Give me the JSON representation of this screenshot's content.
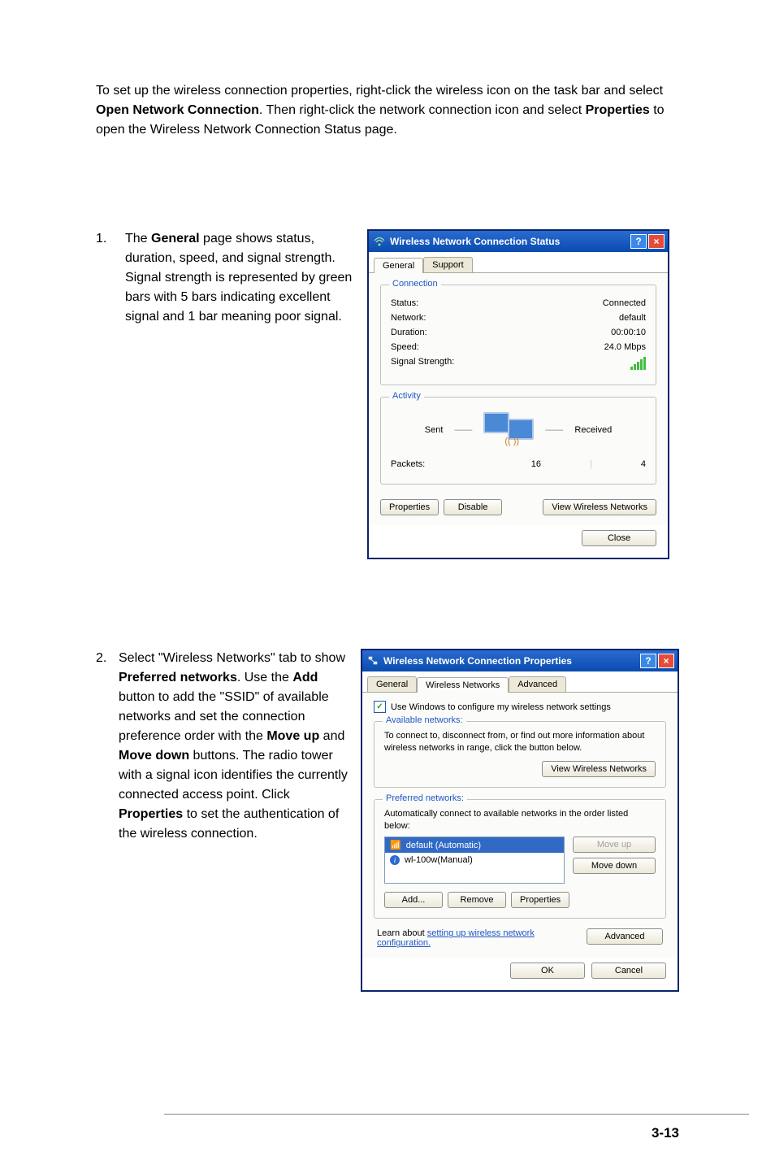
{
  "intro": {
    "p1_a": "To set up the wireless connection properties, right-click the wireless icon on the task bar and select ",
    "p1_b": "Open Network Connection",
    "p1_c": ". Then right-click the network connection icon and select ",
    "p1_d": "Properties",
    "p1_e": " to open the Wireless Network Connection Status page."
  },
  "steps": {
    "s1": {
      "num": "1.",
      "t1": "The ",
      "t2": "General",
      "t3": " page shows status, duration, speed, and signal strength. Signal strength is represented by green bars with 5 bars indicating excellent signal and 1 bar meaning poor signal."
    },
    "s2": {
      "num": "2.",
      "t1": "Select \"Wireless Networks\" tab to show ",
      "t2": "Preferred networks",
      "t3": ". Use the ",
      "t4": "Add",
      "t5": " button to add the \"SSID\" of available networks and set the connection preference order with the ",
      "t6": "Move up",
      "t7": " and ",
      "t8": "Move down",
      "t9": " buttons. The radio tower with a signal icon identifies the currently connected access point. Click ",
      "t10": "Properties",
      "t11": " to set the authentication of the wireless connection."
    }
  },
  "dlg1": {
    "title": "Wireless Network Connection Status",
    "help": "?",
    "close": "×",
    "tabs": {
      "general": "General",
      "support": "Support"
    },
    "conn": {
      "legend": "Connection",
      "status_l": "Status:",
      "status_v": "Connected",
      "network_l": "Network:",
      "network_v": "default",
      "duration_l": "Duration:",
      "duration_v": "00:00:10",
      "speed_l": "Speed:",
      "speed_v": "24.0 Mbps",
      "signal_l": "Signal Strength:"
    },
    "act": {
      "legend": "Activity",
      "sent": "Sent",
      "received": "Received",
      "packets_l": "Packets:",
      "packets_sent": "16",
      "packets_recv": "4"
    },
    "btns": {
      "properties": "Properties",
      "disable": "Disable",
      "view": "View Wireless Networks",
      "close": "Close"
    }
  },
  "dlg2": {
    "title": "Wireless Network Connection Properties",
    "help": "?",
    "close": "×",
    "tabs": {
      "general": "General",
      "wireless": "Wireless Networks",
      "advanced": "Advanced"
    },
    "use_windows": "Use Windows to configure my wireless network settings",
    "avail": {
      "legend": "Available networks:",
      "desc": "To connect to, disconnect from, or find out more information about wireless networks in range, click the button below.",
      "view": "View Wireless Networks"
    },
    "pref": {
      "legend": "Preferred networks:",
      "desc": "Automatically connect to available networks in the order listed below:",
      "items": {
        "i0": "default (Automatic)",
        "i1": "wl-100w(Manual)"
      },
      "move_up": "Move up",
      "move_down": "Move down",
      "add": "Add...",
      "remove": "Remove",
      "properties": "Properties"
    },
    "learn": {
      "a": "Learn about ",
      "link": "setting up wireless network configuration.",
      "advanced": "Advanced"
    },
    "footer": {
      "ok": "OK",
      "cancel": "Cancel"
    }
  },
  "page_num": "3-13"
}
